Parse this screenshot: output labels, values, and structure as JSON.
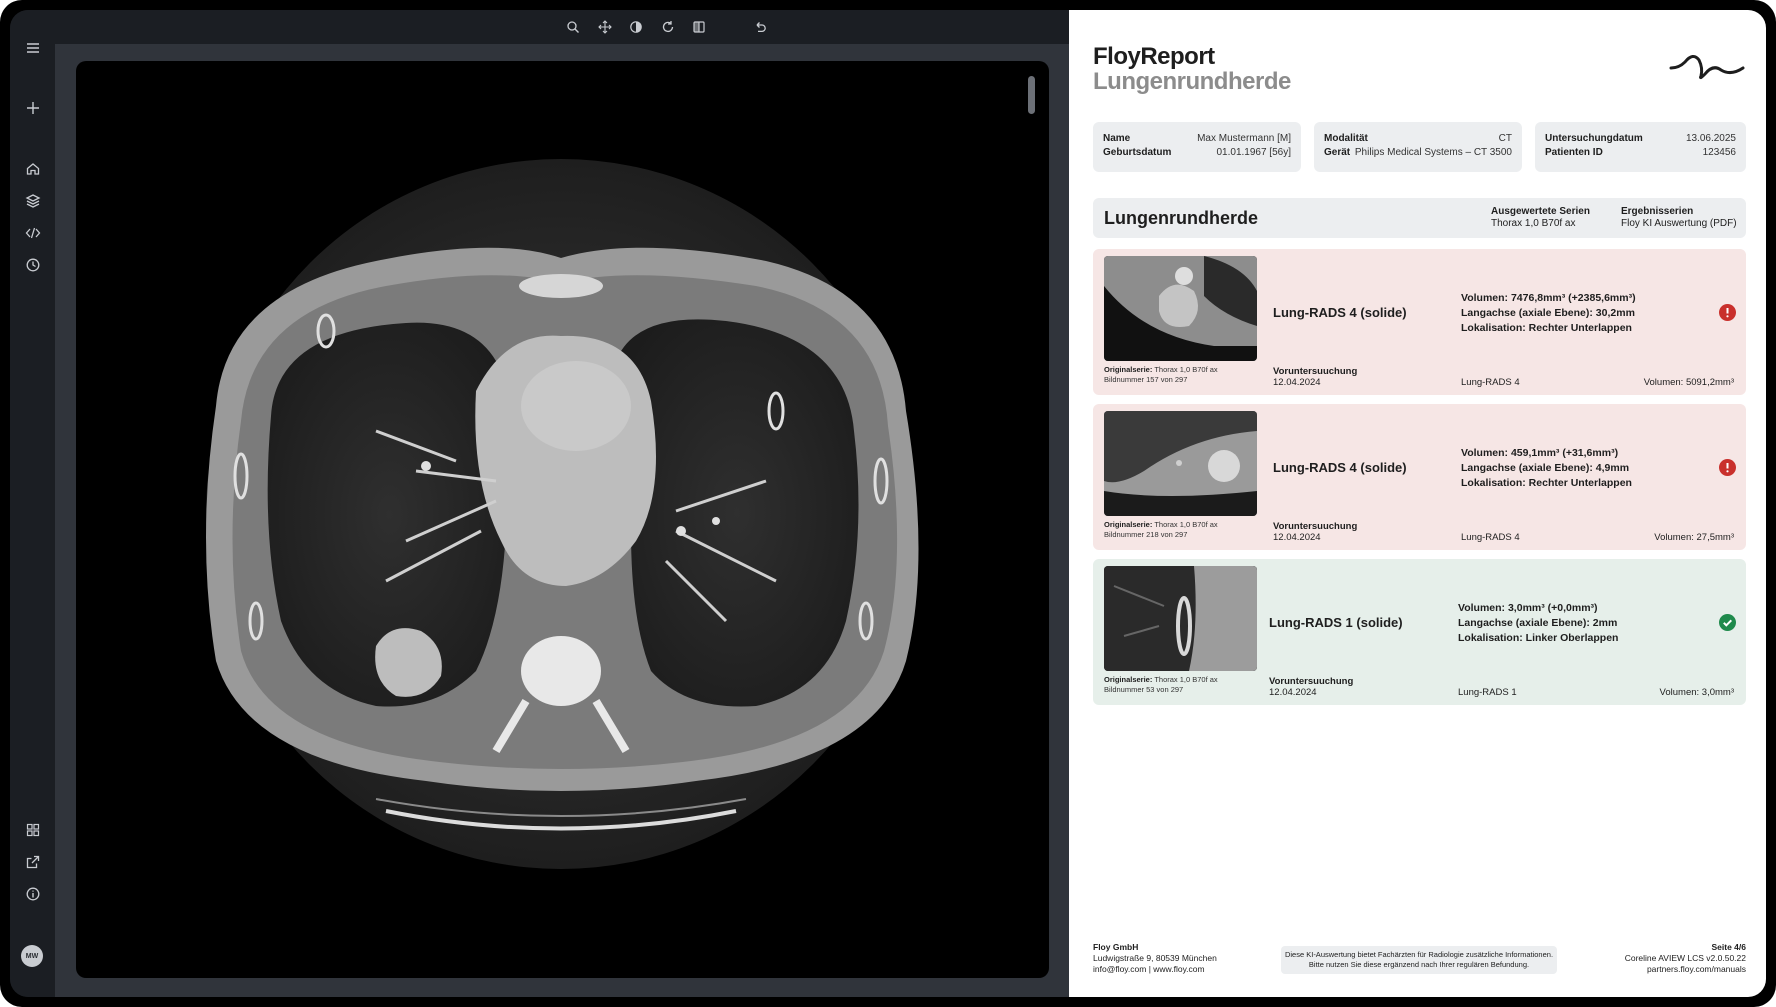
{
  "viewer": {
    "sidebar_icons": [
      "menu-icon",
      "plus-icon",
      "home-icon",
      "layers-icon",
      "code-icon",
      "history-icon",
      "grid-icon",
      "external-link-icon",
      "info-icon"
    ],
    "toolbar_icons": [
      "zoom-icon",
      "pan-icon",
      "contrast-icon",
      "rotate-icon",
      "split-view-icon",
      "undo-icon"
    ],
    "user_initials": "MW"
  },
  "report": {
    "brand_line1": "FloyReport",
    "brand_line2": "Lungenrundherde",
    "patient": {
      "name_label": "Name",
      "name_value": "Max Mustermann [M]",
      "dob_label": "Geburtsdatum",
      "dob_value": "01.01.1967 [56y]"
    },
    "device": {
      "modality_label": "Modalität",
      "modality_value": "CT",
      "device_label": "Gerät",
      "device_value": "Philips Medical Systems – CT 3500"
    },
    "exam": {
      "date_label": "Untersuchungdatum",
      "date_value": "13.06.2025",
      "pid_label": "Patienten ID",
      "pid_value": "123456"
    },
    "section": {
      "title": "Lungenrundherde",
      "series_label": "Ausgewertete Serien",
      "series_value": "Thorax 1,0 B70f ax",
      "result_label": "Ergebnisserien",
      "result_value": "Floy KI Auswertung (PDF)"
    },
    "findings": [
      {
        "status": "alert",
        "caption_label": "Originalserie:",
        "caption_series": "Thorax 1,0 B70f ax",
        "caption_image": "Bildnummer 157 von 297",
        "title": "Lung-RADS 4 (solide)",
        "volume": "Volumen: 7476,8mm³ (+2385,6mm³)",
        "axis": "Langachse (axiale Ebene): 30,2mm",
        "location": "Lokalisation: Rechter Unterlappen",
        "prev_label": "Voruntersuuchung",
        "prev_date": "12.04.2024",
        "prev_rads": "Lung-RADS 4",
        "prev_volume": "Volumen: 5091,2mm³"
      },
      {
        "status": "alert",
        "caption_label": "Originalserie:",
        "caption_series": "Thorax 1,0 B70f ax",
        "caption_image": "Bildnummer 218 von 297",
        "title": "Lung-RADS 4 (solide)",
        "volume": "Volumen: 459,1mm³ (+31,6mm³)",
        "axis": "Langachse (axiale Ebene): 4,9mm",
        "location": "Lokalisation: Rechter Unterlappen",
        "prev_label": "Voruntersuuchung",
        "prev_date": "12.04.2024",
        "prev_rads": "Lung-RADS 4",
        "prev_volume": "Volumen: 27,5mm³"
      },
      {
        "status": "ok",
        "caption_label": "Originalserie:",
        "caption_series": "Thorax 1,0 B70f ax",
        "caption_image": "Bildnummer 53 von 297",
        "title": "Lung-RADS 1 (solide)",
        "volume": "Volumen: 3,0mm³ (+0,0mm³)",
        "axis": "Langachse (axiale Ebene): 2mm",
        "location": "Lokalisation: Linker Oberlappen",
        "prev_label": "Voruntersuuchung",
        "prev_date": "12.04.2024",
        "prev_rads": "Lung-RADS 1",
        "prev_volume": "Volumen: 3,0mm³"
      }
    ],
    "footer": {
      "company": "Floy GmbH",
      "address": "Ludwigstraße 9, 80539 München",
      "contact": "info@floy.com | www.floy.com",
      "disclaimer1": "Diese KI-Auswertung bietet Fachärzten für Radiologie zusätzliche Informationen.",
      "disclaimer2": "Bitte nutzen Sie diese ergänzend nach Ihrer regulären Befundung.",
      "page": "Seite 4/6",
      "software": "Coreline AVIEW LCS v2.0.50.22",
      "manuals": "partners.floy.com/manuals"
    },
    "colors": {
      "alert_bg": "#f6e6e5",
      "ok_bg": "#e6efea",
      "alert_icon": "#c9302c",
      "ok_icon": "#1f8a4c"
    }
  }
}
